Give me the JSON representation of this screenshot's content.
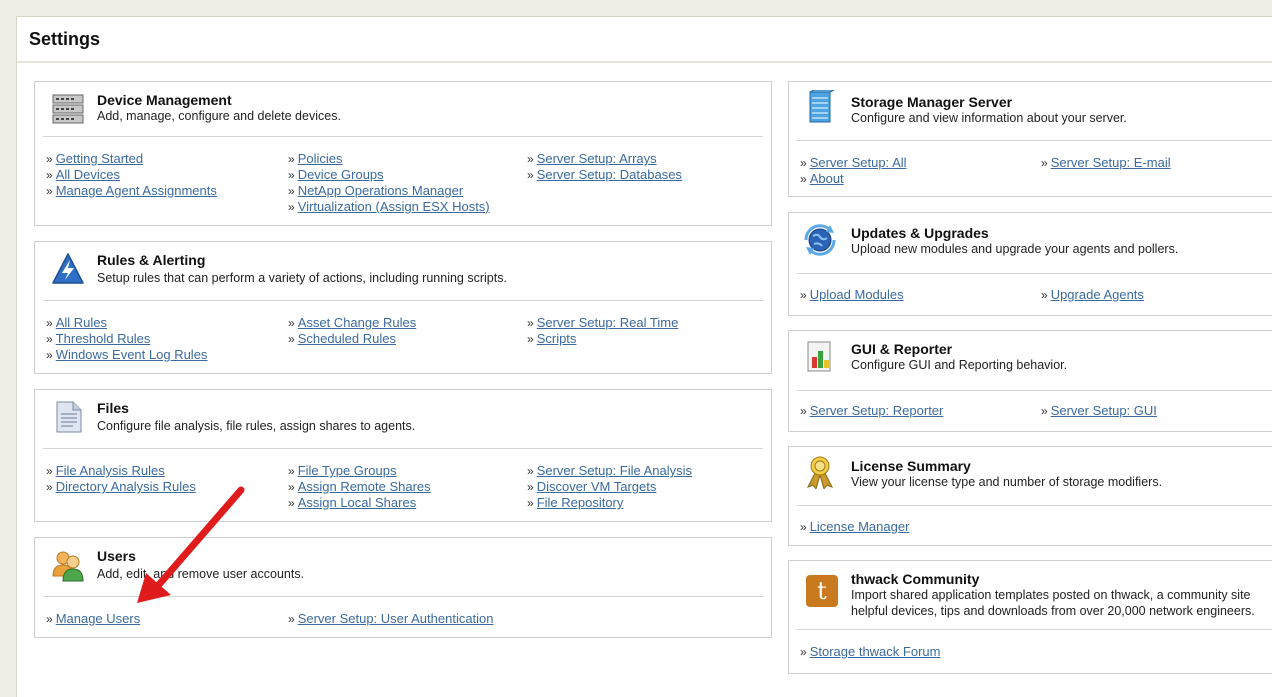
{
  "page": {
    "title": "Settings"
  },
  "panels": {
    "device_management": {
      "title": "Device Management",
      "desc": "Add, manage, configure and delete devices.",
      "links": [
        "Getting Started",
        "All Devices",
        "Manage Agent Assignments",
        "Policies",
        "Device Groups",
        "NetApp Operations Manager",
        "Virtualization (Assign ESX Hosts)",
        "Server Setup: Arrays",
        "Server Setup: Databases"
      ]
    },
    "rules_alerting": {
      "title": "Rules & Alerting",
      "desc": "Setup rules that can perform a variety of actions, including running scripts.",
      "links": [
        "All Rules",
        "Threshold Rules",
        "Windows Event Log Rules",
        "Asset Change Rules",
        "Scheduled Rules",
        "Server Setup: Real Time",
        "Scripts"
      ]
    },
    "files": {
      "title": "Files",
      "desc": "Configure file analysis, file rules, assign shares to agents.",
      "links": [
        "File Analysis Rules",
        "Directory Analysis Rules",
        "File Type Groups",
        "Assign Remote Shares",
        "Assign Local Shares",
        "Server Setup: File Analysis",
        "Discover VM Targets",
        "File Repository"
      ]
    },
    "users": {
      "title": "Users",
      "desc": "Add, edit, and remove user accounts.",
      "links": [
        "Manage Users",
        "Server Setup: User Authentication"
      ]
    },
    "storage_manager_server": {
      "title": "Storage Manager Server",
      "desc": "Configure and view information about your server.",
      "links": [
        "Server Setup: All",
        "About",
        "Server Setup: E-mail"
      ]
    },
    "updates_upgrades": {
      "title": "Updates & Upgrades",
      "desc": "Upload new modules and upgrade your agents and pollers.",
      "links": [
        "Upload Modules",
        "Upgrade Agents"
      ]
    },
    "gui_reporter": {
      "title": "GUI & Reporter",
      "desc": "Configure GUI and Reporting behavior.",
      "links": [
        "Server Setup: Reporter",
        "Server Setup: GUI"
      ]
    },
    "license_summary": {
      "title": "License Summary",
      "desc": "View your license type and number of storage modifiers.",
      "links": [
        "License Manager"
      ]
    },
    "thwack_community": {
      "title": "thwack Community",
      "desc_line1": "Import shared application templates posted on thwack, a community site",
      "desc_line2": "helpful devices, tips and downloads from over 20,000 network engineers.",
      "icon_letter": "t",
      "links": [
        "Storage thwack Forum"
      ]
    }
  },
  "separator": "»",
  "colors": {
    "link": "#3b6aa0",
    "arrow": "#e01b1b",
    "thwack": "#c97a1e"
  },
  "annotation": {
    "type": "red-arrow",
    "target": "Manage Users"
  }
}
